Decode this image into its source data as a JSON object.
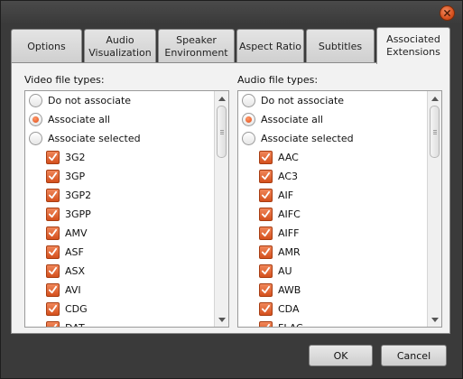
{
  "window": {
    "close_icon": "close-icon",
    "accent": "#e0561f"
  },
  "tabs": [
    {
      "label": "Options",
      "active": false
    },
    {
      "label": "Audio\nVisualization",
      "active": false
    },
    {
      "label": "Speaker\nEnvironment",
      "active": false
    },
    {
      "label": "Aspect Ratio",
      "active": false
    },
    {
      "label": "Subtitles",
      "active": false
    },
    {
      "label": "Associated\nExtensions",
      "active": true
    }
  ],
  "video": {
    "label": "Video file types:",
    "options": [
      {
        "label": "Do not associate",
        "selected": false
      },
      {
        "label": "Associate all",
        "selected": true
      },
      {
        "label": "Associate selected",
        "selected": false
      }
    ],
    "extensions": [
      "3G2",
      "3GP",
      "3GP2",
      "3GPP",
      "AMV",
      "ASF",
      "ASX",
      "AVI",
      "CDG",
      "DAT"
    ]
  },
  "audio": {
    "label": "Audio file types:",
    "options": [
      {
        "label": "Do not associate",
        "selected": false
      },
      {
        "label": "Associate all",
        "selected": true
      },
      {
        "label": "Associate selected",
        "selected": false
      }
    ],
    "extensions": [
      "AAC",
      "AC3",
      "AIF",
      "AIFC",
      "AIFF",
      "AMR",
      "AU",
      "AWB",
      "CDA",
      "FLAC"
    ]
  },
  "buttons": {
    "ok": "OK",
    "cancel": "Cancel"
  }
}
